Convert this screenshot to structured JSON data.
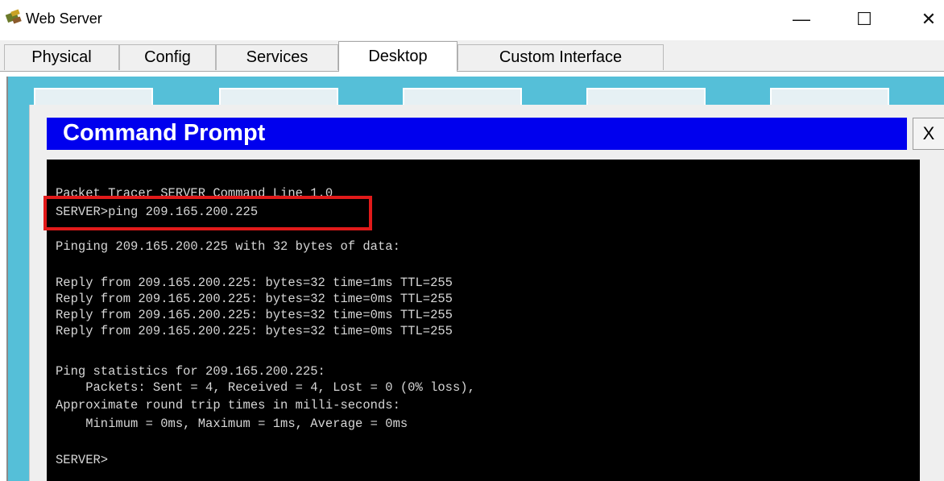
{
  "window": {
    "title": "Web Server",
    "minimize": "—",
    "maximize": "☐",
    "close": "✕"
  },
  "tabs": [
    {
      "label": "Physical"
    },
    {
      "label": "Config"
    },
    {
      "label": "Services"
    },
    {
      "label": "Desktop",
      "active": true
    },
    {
      "label": "Custom Interface"
    }
  ],
  "command_prompt": {
    "title": "Command Prompt",
    "close_label": "X",
    "lines": [
      "Packet Tracer SERVER Command Line 1.0",
      "SERVER>ping 209.165.200.225",
      "Pinging 209.165.200.225 with 32 bytes of data:",
      "Reply from 209.165.200.225: bytes=32 time=1ms TTL=255",
      "Reply from 209.165.200.225: bytes=32 time=0ms TTL=255",
      "Reply from 209.165.200.225: bytes=32 time=0ms TTL=255",
      "Reply from 209.165.200.225: bytes=32 time=0ms TTL=255",
      "Ping statistics for 209.165.200.225:",
      "    Packets: Sent = 4, Received = 4, Lost = 0 (0% loss),",
      "Approximate round trip times in milli-seconds:",
      "    Minimum = 0ms, Maximum = 1ms, Average = 0ms",
      "SERVER>"
    ]
  },
  "colors": {
    "desktop_bg": "#55bfd8",
    "cmd_header": "#0000ee",
    "terminal_bg": "#000000",
    "highlight": "#e11a1a"
  }
}
